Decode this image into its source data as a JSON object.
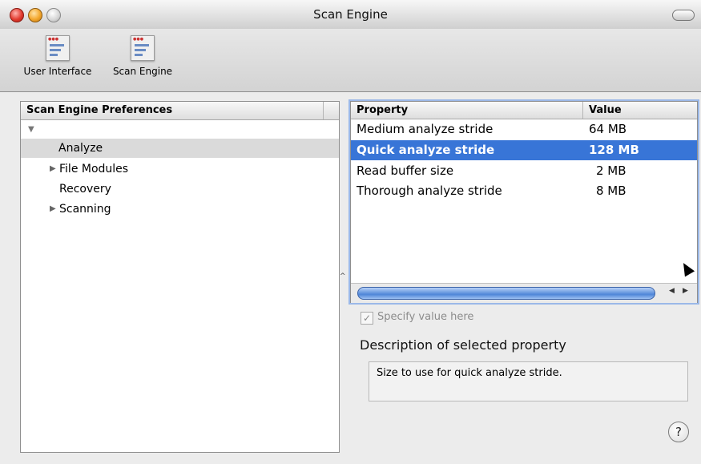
{
  "window": {
    "title": "Scan Engine"
  },
  "toolbar": {
    "items": [
      {
        "label": "User Interface",
        "icon": "preferences-window-icon"
      },
      {
        "label": "Scan Engine",
        "icon": "preferences-window-icon"
      }
    ]
  },
  "tree": {
    "header": "Scan Engine Preferences",
    "items": [
      {
        "label": "",
        "expander": "expanded"
      },
      {
        "label": "Analyze",
        "selected": true
      },
      {
        "label": "File Modules",
        "expander": "collapsed"
      },
      {
        "label": "Recovery"
      },
      {
        "label": "Scanning",
        "expander": "collapsed"
      }
    ]
  },
  "properties": {
    "columns": [
      "Property",
      "Value"
    ],
    "rows": [
      {
        "property": "Medium analyze stride",
        "value": "64 MB"
      },
      {
        "property": "Quick analyze stride",
        "value": "128 MB",
        "selected": true
      },
      {
        "property": "Read buffer size",
        "value": "2 MB"
      },
      {
        "property": "Thorough analyze stride",
        "value": "8 MB"
      }
    ]
  },
  "specify": {
    "label": "Specify value here",
    "checked": true,
    "enabled": false
  },
  "description": {
    "title": "Description of selected property",
    "text": "Size to use for quick analyze stride."
  },
  "help": {
    "label": "?"
  },
  "colors": {
    "selection": "#3875d7",
    "tree_selection": "#dadada"
  }
}
